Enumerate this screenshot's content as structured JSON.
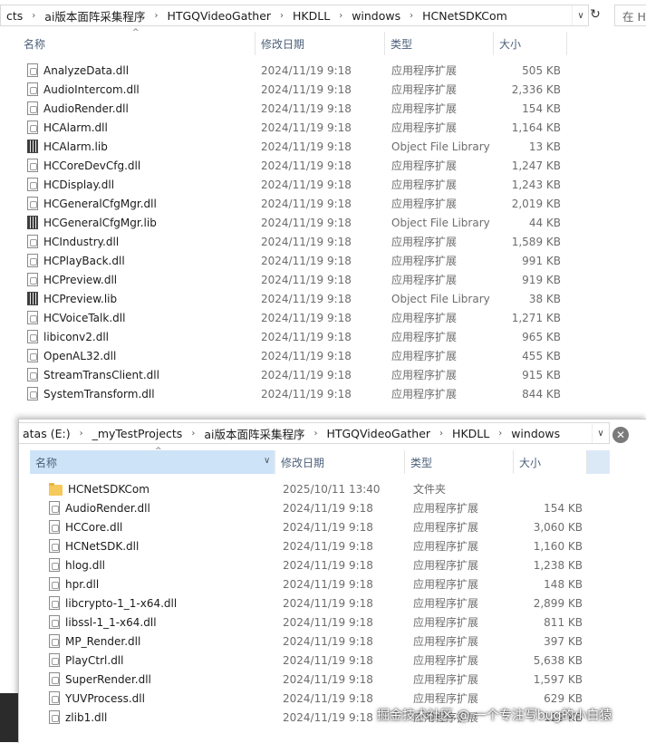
{
  "win1": {
    "breadcrumb": [
      "cts",
      "ai版本面阵采集程序",
      "HTGQVideoGather",
      "HKDLL",
      "windows",
      "HCNetSDKCom"
    ],
    "search_placeholder": "在 H",
    "refresh_glyph": "↻",
    "dropdown_glyph": "∨",
    "columns": {
      "name": "名称",
      "date": "修改日期",
      "type": "类型",
      "size": "大小"
    },
    "sort_glyph": "^",
    "files": [
      {
        "icon": "dll",
        "name": "AnalyzeData.dll",
        "date": "2024/11/19 9:18",
        "type": "应用程序扩展",
        "size": "505 KB"
      },
      {
        "icon": "dll",
        "name": "AudioIntercom.dll",
        "date": "2024/11/19 9:18",
        "type": "应用程序扩展",
        "size": "2,336 KB"
      },
      {
        "icon": "dll",
        "name": "AudioRender.dll",
        "date": "2024/11/19 9:18",
        "type": "应用程序扩展",
        "size": "154 KB"
      },
      {
        "icon": "dll",
        "name": "HCAlarm.dll",
        "date": "2024/11/19 9:18",
        "type": "应用程序扩展",
        "size": "1,164 KB"
      },
      {
        "icon": "lib",
        "name": "HCAlarm.lib",
        "date": "2024/11/19 9:18",
        "type": "Object File Library",
        "size": "13 KB"
      },
      {
        "icon": "dll",
        "name": "HCCoreDevCfg.dll",
        "date": "2024/11/19 9:18",
        "type": "应用程序扩展",
        "size": "1,247 KB"
      },
      {
        "icon": "dll",
        "name": "HCDisplay.dll",
        "date": "2024/11/19 9:18",
        "type": "应用程序扩展",
        "size": "1,243 KB"
      },
      {
        "icon": "dll",
        "name": "HCGeneralCfgMgr.dll",
        "date": "2024/11/19 9:18",
        "type": "应用程序扩展",
        "size": "2,019 KB"
      },
      {
        "icon": "lib",
        "name": "HCGeneralCfgMgr.lib",
        "date": "2024/11/19 9:18",
        "type": "Object File Library",
        "size": "44 KB"
      },
      {
        "icon": "dll",
        "name": "HCIndustry.dll",
        "date": "2024/11/19 9:18",
        "type": "应用程序扩展",
        "size": "1,589 KB"
      },
      {
        "icon": "dll",
        "name": "HCPlayBack.dll",
        "date": "2024/11/19 9:18",
        "type": "应用程序扩展",
        "size": "991 KB"
      },
      {
        "icon": "dll",
        "name": "HCPreview.dll",
        "date": "2024/11/19 9:18",
        "type": "应用程序扩展",
        "size": "919 KB"
      },
      {
        "icon": "lib",
        "name": "HCPreview.lib",
        "date": "2024/11/19 9:18",
        "type": "Object File Library",
        "size": "38 KB"
      },
      {
        "icon": "dll",
        "name": "HCVoiceTalk.dll",
        "date": "2024/11/19 9:18",
        "type": "应用程序扩展",
        "size": "1,271 KB"
      },
      {
        "icon": "dll",
        "name": "libiconv2.dll",
        "date": "2024/11/19 9:18",
        "type": "应用程序扩展",
        "size": "965 KB"
      },
      {
        "icon": "dll",
        "name": "OpenAL32.dll",
        "date": "2024/11/19 9:18",
        "type": "应用程序扩展",
        "size": "455 KB"
      },
      {
        "icon": "dll",
        "name": "StreamTransClient.dll",
        "date": "2024/11/19 9:18",
        "type": "应用程序扩展",
        "size": "915 KB"
      },
      {
        "icon": "dll",
        "name": "SystemTransform.dll",
        "date": "2024/11/19 9:18",
        "type": "应用程序扩展",
        "size": "844 KB"
      }
    ]
  },
  "win2": {
    "breadcrumb": [
      "atas (E:)",
      "_myTestProjects",
      "ai版本面阵采集程序",
      "HTGQVideoGather",
      "HKDLL",
      "windows"
    ],
    "dropdown_glyph": "∨",
    "close_glyph": "✕",
    "columns": {
      "name": "名称",
      "date": "修改日期",
      "type": "类型",
      "size": "大小"
    },
    "sort_glyph": "^",
    "files": [
      {
        "icon": "folder",
        "name": "HCNetSDKCom",
        "date": "2025/10/11 13:40",
        "type": "文件夹",
        "size": ""
      },
      {
        "icon": "dll",
        "name": "AudioRender.dll",
        "date": "2024/11/19 9:18",
        "type": "应用程序扩展",
        "size": "154 KB"
      },
      {
        "icon": "dll",
        "name": "HCCore.dll",
        "date": "2024/11/19 9:18",
        "type": "应用程序扩展",
        "size": "3,060 KB"
      },
      {
        "icon": "dll",
        "name": "HCNetSDK.dll",
        "date": "2024/11/19 9:18",
        "type": "应用程序扩展",
        "size": "1,160 KB"
      },
      {
        "icon": "dll",
        "name": "hlog.dll",
        "date": "2024/11/19 9:18",
        "type": "应用程序扩展",
        "size": "1,238 KB"
      },
      {
        "icon": "dll",
        "name": "hpr.dll",
        "date": "2024/11/19 9:18",
        "type": "应用程序扩展",
        "size": "148 KB"
      },
      {
        "icon": "dll",
        "name": "libcrypto-1_1-x64.dll",
        "date": "2024/11/19 9:18",
        "type": "应用程序扩展",
        "size": "2,899 KB"
      },
      {
        "icon": "dll",
        "name": "libssl-1_1-x64.dll",
        "date": "2024/11/19 9:18",
        "type": "应用程序扩展",
        "size": "811 KB"
      },
      {
        "icon": "dll",
        "name": "MP_Render.dll",
        "date": "2024/11/19 9:18",
        "type": "应用程序扩展",
        "size": "397 KB"
      },
      {
        "icon": "dll",
        "name": "PlayCtrl.dll",
        "date": "2024/11/19 9:18",
        "type": "应用程序扩展",
        "size": "5,638 KB"
      },
      {
        "icon": "dll",
        "name": "SuperRender.dll",
        "date": "2024/11/19 9:18",
        "type": "应用程序扩展",
        "size": "1,597 KB"
      },
      {
        "icon": "dll",
        "name": "YUVProcess.dll",
        "date": "2024/11/19 9:18",
        "type": "应用程序扩展",
        "size": "629 KB"
      },
      {
        "icon": "dll",
        "name": "zlib1.dll",
        "date": "2024/11/19 9:18",
        "type": "应用程序扩展",
        "size": "129 KB"
      }
    ]
  },
  "watermark": "掘金技术社区 @ 一个专注写bug的小白猿"
}
